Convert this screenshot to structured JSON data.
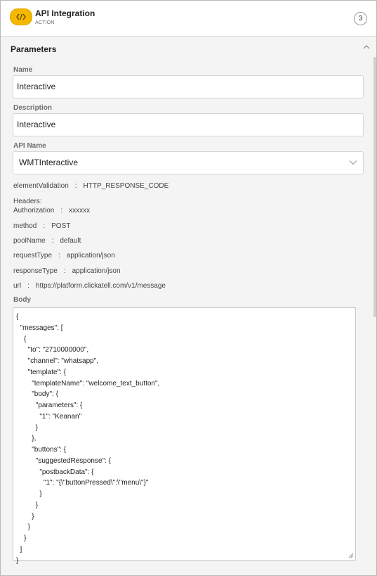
{
  "header": {
    "icon": "code-icon",
    "title": "API Integration",
    "subtitle": "ACTION",
    "step_number": "3",
    "badge_color": "#f5b800"
  },
  "section": {
    "title": "Parameters",
    "collapse_icon": "chevron-up-icon"
  },
  "form": {
    "name_label": "Name",
    "name_value": "Interactive",
    "description_label": "Description",
    "description_value": "Interactive",
    "api_name_label": "API Name",
    "api_name_value": "WMTInteractive",
    "body_label": "Body"
  },
  "details": {
    "element_validation_key": "elementValidation",
    "element_validation_value": "HTTP_RESPONSE_CODE",
    "headers_label": "Headers:",
    "authorization_key": "Authorization",
    "authorization_value": "xxxxxx",
    "method_key": "method",
    "method_value": "POST",
    "pool_name_key": "poolName",
    "pool_name_value": "default",
    "request_type_key": "requestType",
    "request_type_value": "application/json",
    "response_type_key": "responseType",
    "response_type_value": "application/json",
    "url_key": "url",
    "url_value": "https://platform.clickatell.com/v1/message",
    "separator": ":"
  },
  "body_text": "{\n  \"messages\": [\n    {\n      \"to\": \"2710000000\",\n      \"channel\": \"whatsapp\",\n      \"template\": {\n        \"templateName\": \"welcome_text_button\",\n        \"body\": {\n          \"parameters\": {\n            \"1\": \"Keanan\"\n          }\n        },\n        \"buttons\": {\n          \"suggestedResponse\": {\n            \"postbackData\": {\n              \"1\": \"{\\\"buttonPressed\\\":\\\"menu\\\"}\"\n            }\n          }\n        }\n      }\n    }\n  ]\n}"
}
